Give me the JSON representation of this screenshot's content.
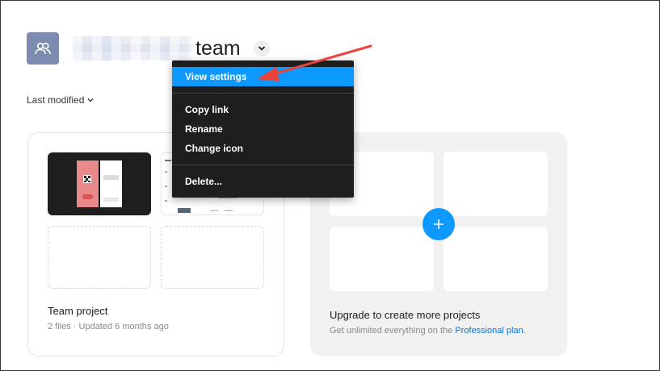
{
  "header": {
    "team_name_suffix": "team",
    "avatar_icon": "users-icon",
    "dropdown_icon": "chevron-down-icon"
  },
  "sort": {
    "label": "Last modified",
    "icon": "chevron-down-icon"
  },
  "menu": {
    "items": [
      {
        "label": "View settings",
        "selected": true
      },
      {
        "label": "Copy link"
      },
      {
        "label": "Rename"
      },
      {
        "label": "Change icon"
      },
      {
        "label": "Delete..."
      }
    ]
  },
  "project_card": {
    "title": "Team project",
    "meta": "2 files · Updated 6 months ago"
  },
  "upgrade_card": {
    "title": "Upgrade to create more projects",
    "subtitle_prefix": "Get unlimited everything on the ",
    "link_text": "Professional plan",
    "subtitle_suffix": "."
  },
  "colors": {
    "accent": "#0d99ff",
    "menu_bg": "#1e1e1e",
    "annotation_arrow": "#e8443a",
    "avatar_bg": "#7d8bb0"
  }
}
